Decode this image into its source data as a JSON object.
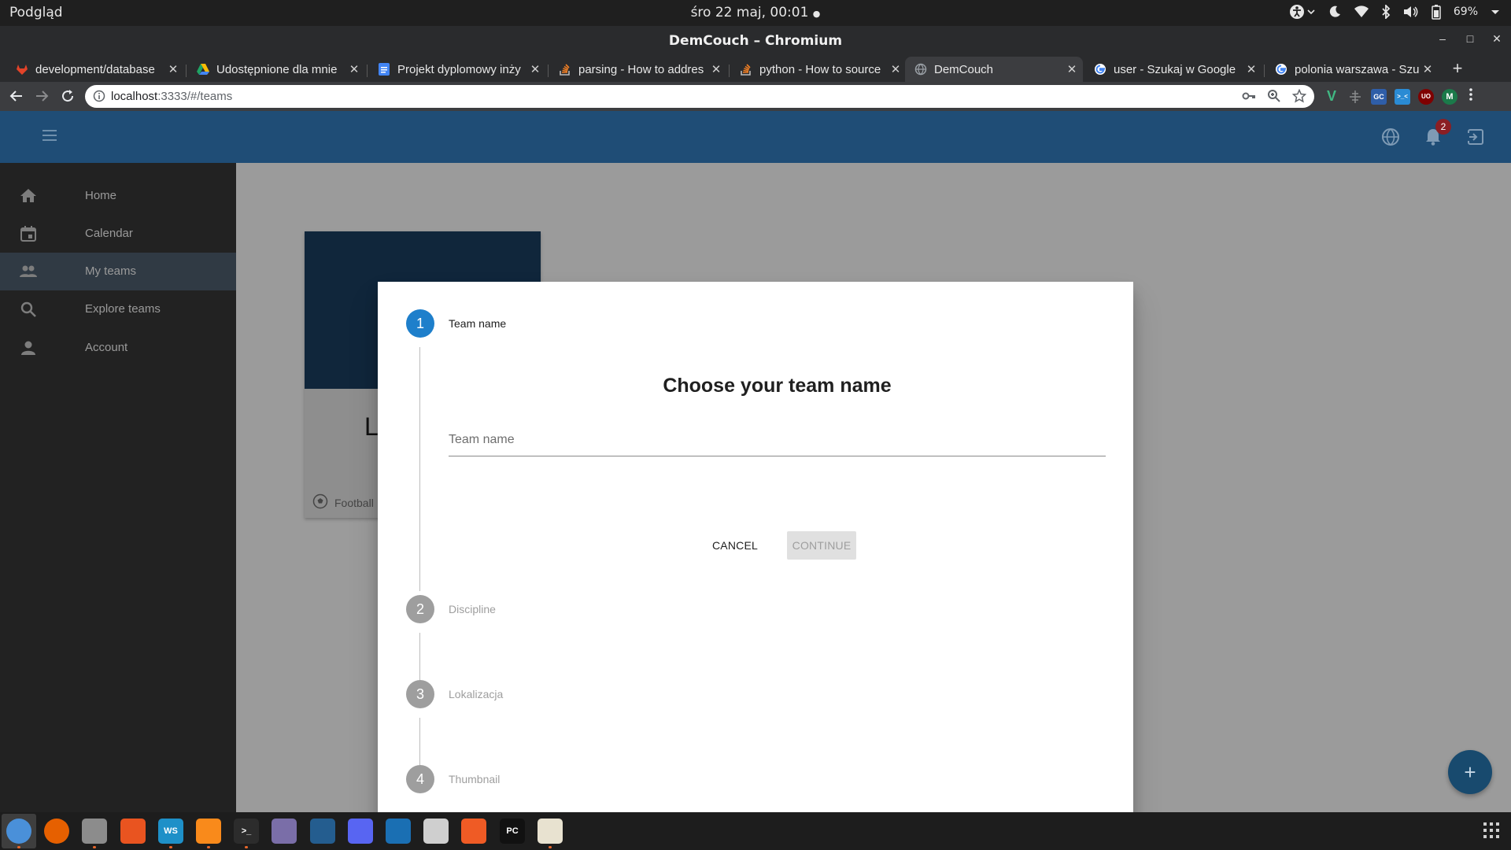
{
  "os": {
    "activity_label": "Podgląd",
    "clock": "śro 22 maj, 00:01",
    "clock_dot": "●",
    "battery": "69%"
  },
  "window": {
    "title": "DemCouch – Chromium",
    "controls": {
      "minimize": "–",
      "maximize": "□",
      "close": "✕"
    }
  },
  "tabs": [
    {
      "label": "development/database",
      "icon": "gitlab-icon",
      "close": "✕"
    },
    {
      "label": "Udostępnione dla mnie",
      "icon": "drive-icon",
      "close": "✕"
    },
    {
      "label": "Projekt dyplomowy inży",
      "icon": "docs-icon",
      "close": "✕"
    },
    {
      "label": "parsing - How to addres",
      "icon": "stackoverflow-icon",
      "close": "✕"
    },
    {
      "label": "python - How to source",
      "icon": "stackoverflow-icon",
      "close": "✕"
    },
    {
      "label": "DemCouch",
      "icon": "globe-icon",
      "close": "✕",
      "active": true
    },
    {
      "label": "user - Szukaj w Google",
      "icon": "google-icon",
      "close": "✕"
    },
    {
      "label": "polonia warszawa - Szuk",
      "icon": "google-icon",
      "close": "✕"
    }
  ],
  "new_tab_label": "+",
  "address": {
    "host": "localhost",
    "path": ":3333/#/teams"
  },
  "extensions": [
    {
      "name": "vue-devtools-icon",
      "label": "V",
      "color": "#41b883"
    },
    {
      "name": "ruler-extension-icon",
      "label": "",
      "color": "#5f6368"
    },
    {
      "name": "gc-extension-icon",
      "label": "GC",
      "color": "#2f5ea8"
    },
    {
      "name": "arrows-extension-icon",
      "label": ">_<",
      "color": "#2a8bd4"
    },
    {
      "name": "ublock-icon",
      "label": "UO",
      "color": "#800000"
    },
    {
      "name": "profile-avatar-icon",
      "label": "M",
      "color": "#1b7a4a"
    }
  ],
  "app": {
    "notification_count": "2",
    "nav": [
      {
        "label": "Home",
        "icon": "home-icon"
      },
      {
        "label": "Calendar",
        "icon": "calendar-icon"
      },
      {
        "label": "My teams",
        "icon": "people-icon",
        "active": true
      },
      {
        "label": "Explore teams",
        "icon": "search-icon"
      },
      {
        "label": "Account",
        "icon": "person-icon"
      }
    ],
    "bg_card": {
      "title_initial": "L",
      "discipline": "Football"
    },
    "fab_label": "+"
  },
  "dialog": {
    "steps": [
      {
        "number": "1",
        "label": "Team name",
        "active": true
      },
      {
        "number": "2",
        "label": "Discipline"
      },
      {
        "number": "3",
        "label": "Lokalizacja"
      },
      {
        "number": "4",
        "label": "Thumbnail"
      }
    ],
    "heading": "Choose your team name",
    "input_placeholder": "Team name",
    "input_value": "",
    "cancel_label": "CANCEL",
    "continue_label": "CONTINUE",
    "continue_disabled": true
  },
  "dock": [
    {
      "name": "chromium-dock-icon",
      "color": "#4a90d9",
      "running": true,
      "active": true
    },
    {
      "name": "firefox-dock-icon",
      "color": "#e66000"
    },
    {
      "name": "files-dock-icon",
      "color": "#8c8c8c",
      "running": true
    },
    {
      "name": "software-center-dock-icon",
      "color": "#e95420"
    },
    {
      "name": "webstorm-dock-icon",
      "color": "#1e90c8",
      "label": "WS",
      "running": true
    },
    {
      "name": "sublime-dock-icon",
      "color": "#f98a1b",
      "running": true
    },
    {
      "name": "terminal-dock-icon",
      "color": "#2c2c2c",
      "label": ">_",
      "running": true
    },
    {
      "name": "crystal-dock-icon",
      "color": "#7a6ea8"
    },
    {
      "name": "mysql-workbench-dock-icon",
      "color": "#245d8f"
    },
    {
      "name": "discord-dock-icon",
      "color": "#5865f2"
    },
    {
      "name": "vscode-dock-icon",
      "color": "#1a6fb3"
    },
    {
      "name": "screenshot-dock-icon",
      "color": "#cfcfcf"
    },
    {
      "name": "postman-dock-icon",
      "color": "#ef5b25"
    },
    {
      "name": "pycharm-dock-icon",
      "color": "#111111",
      "label": "PC"
    },
    {
      "name": "text-editor-dock-icon",
      "color": "#e8e2d0",
      "running": true
    }
  ]
}
